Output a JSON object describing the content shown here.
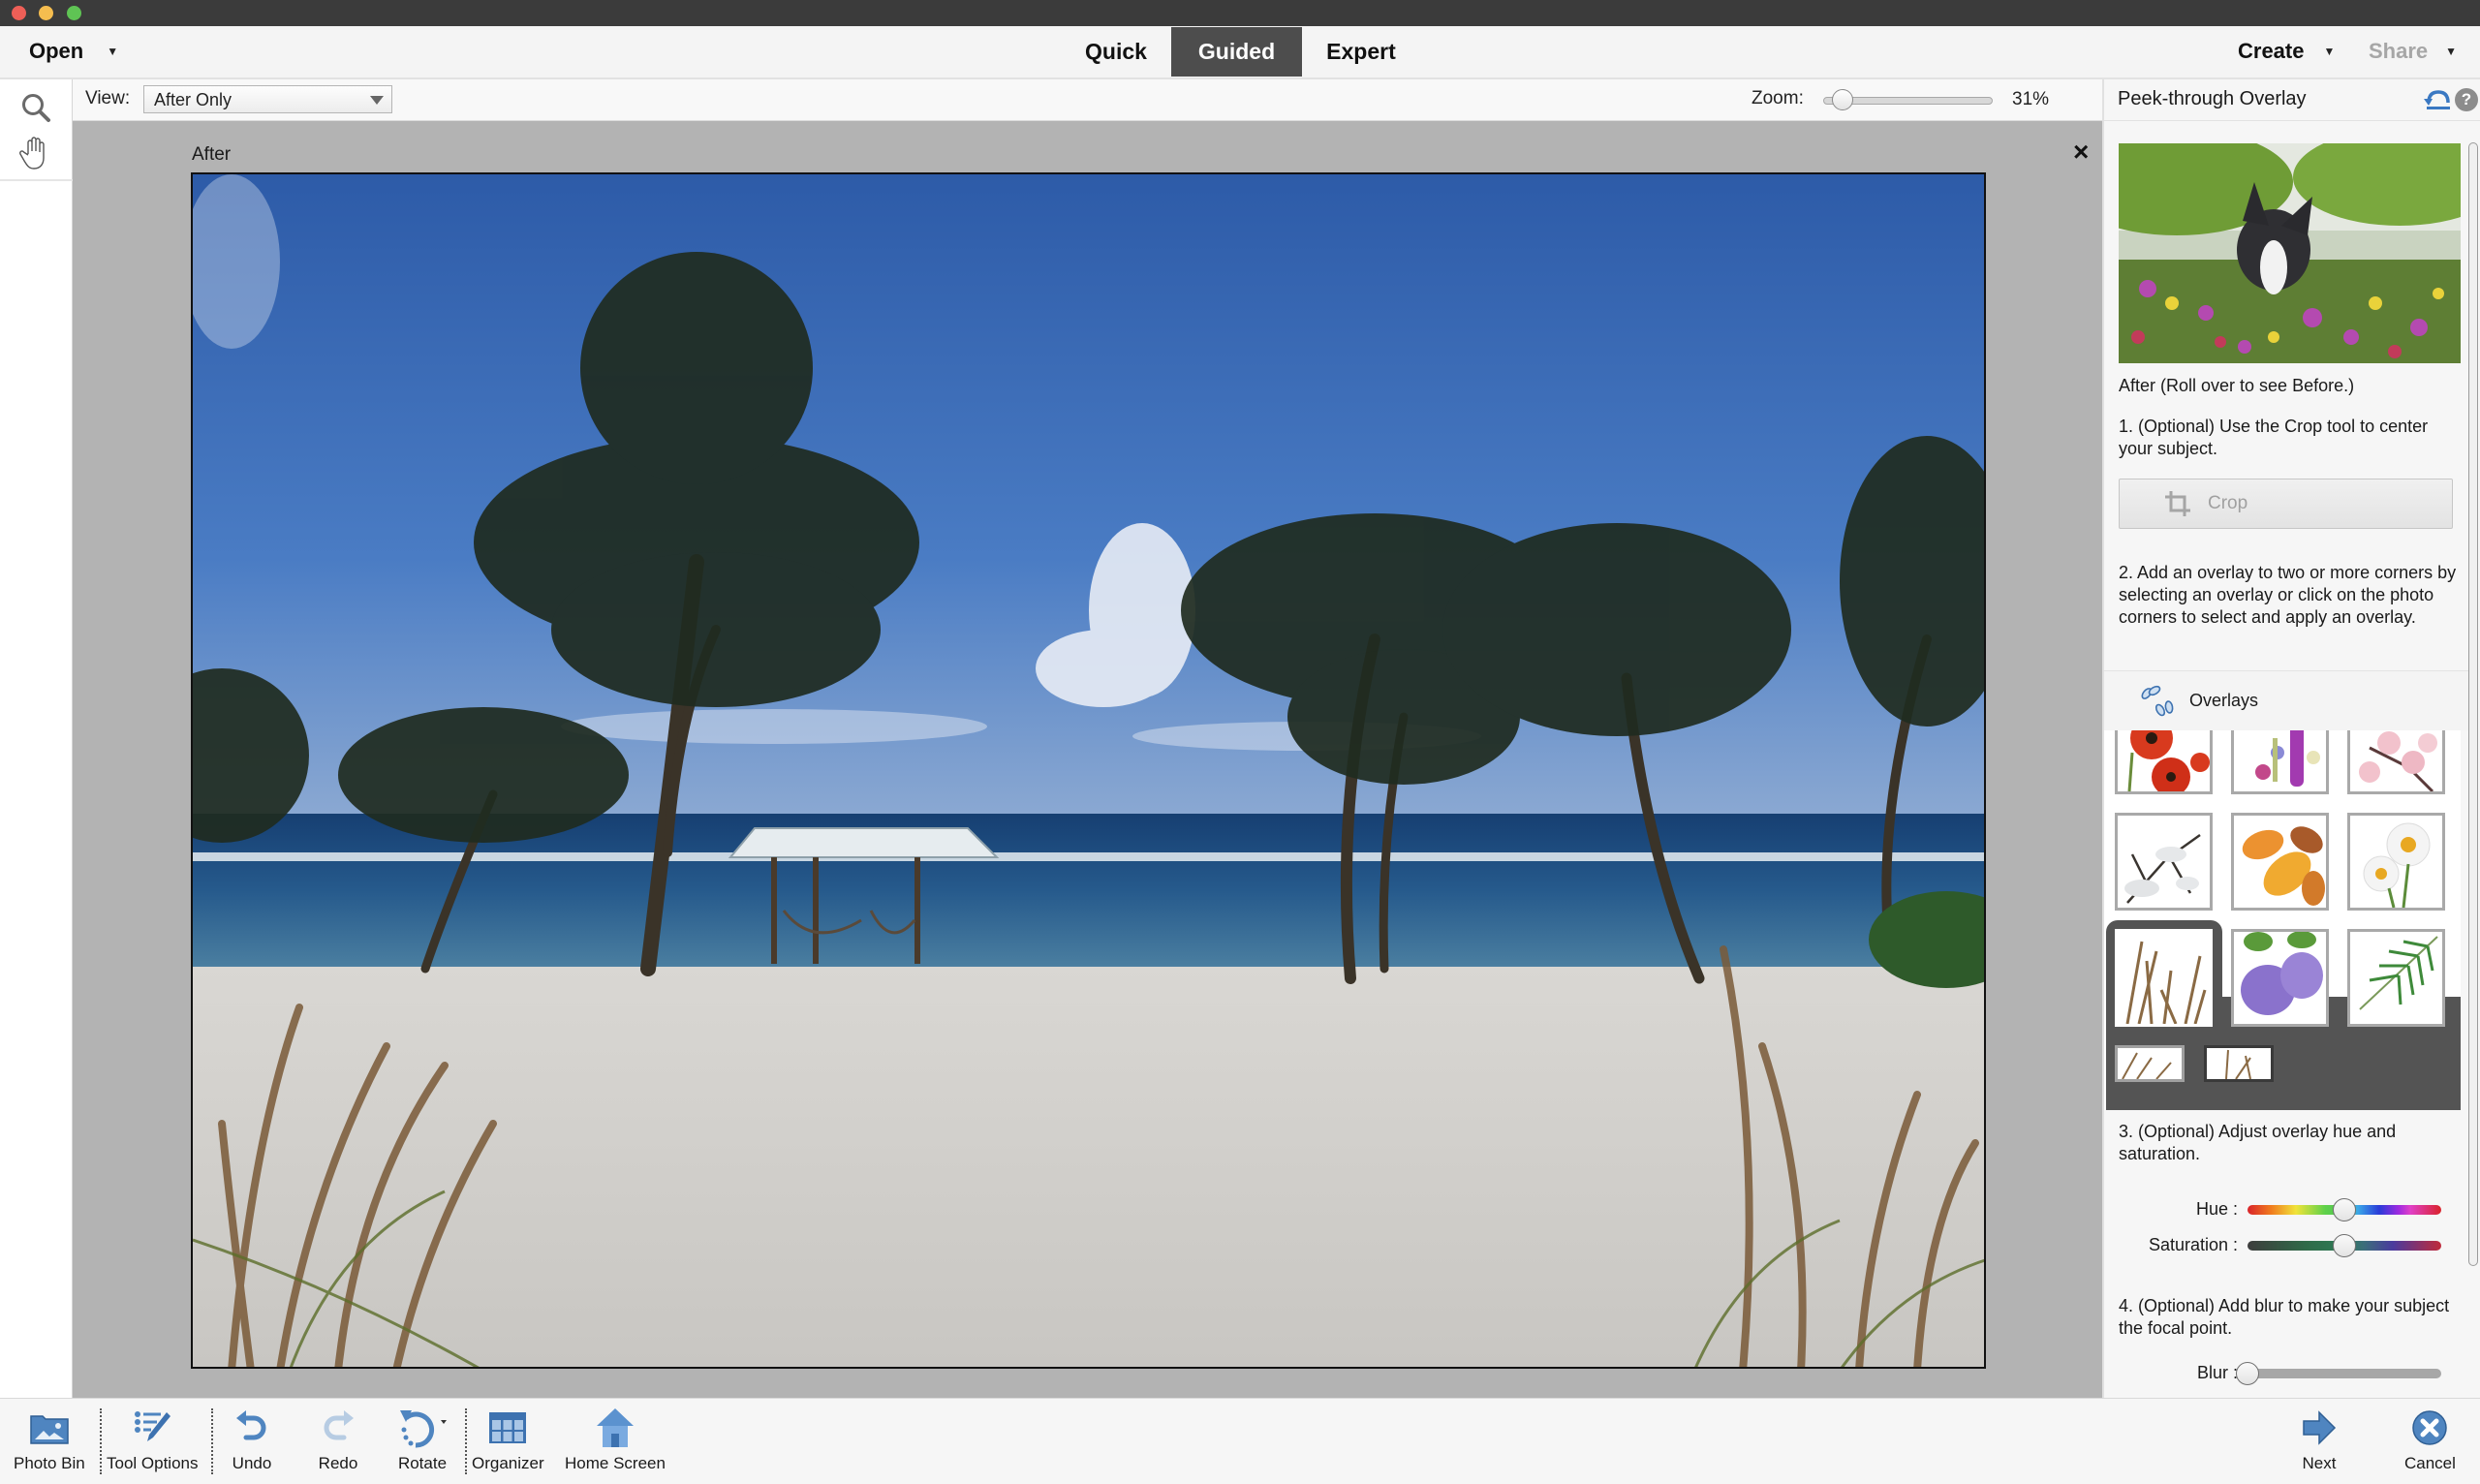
{
  "window": {
    "traffic_lights": [
      "close",
      "minimize",
      "maximize"
    ]
  },
  "topbar": {
    "open_label": "Open",
    "modes": [
      {
        "label": "Quick",
        "active": false
      },
      {
        "label": "Guided",
        "active": true
      },
      {
        "label": "Expert",
        "active": false
      }
    ],
    "create_label": "Create",
    "share_label": "Share"
  },
  "options": {
    "view_label": "View:",
    "view_value": "After Only",
    "zoom_label": "Zoom:",
    "zoom_value": "31%",
    "zoom_percent": 31
  },
  "tools": [
    {
      "name": "zoom-tool",
      "icon": "magnifier-icon"
    },
    {
      "name": "hand-tool",
      "icon": "hand-icon"
    }
  ],
  "canvas": {
    "label": "After",
    "close_symbol": "×",
    "photo_description": "Beach with palm trees, gazebo with hammocks, ocean and sea grass in foreground"
  },
  "panel": {
    "title": "Peek-through Overlay",
    "preview_caption": "After (Roll over to see Before.)",
    "step1": "1. (Optional) Use the Crop tool to center your subject.",
    "crop_label": "Crop",
    "step2": "2. Add an overlay to two or more corners by selecting an overlay or click on the photo corners to select and apply an overlay.",
    "overlays_label": "Overlays",
    "overlays": [
      {
        "name": "poppies",
        "selected": false
      },
      {
        "name": "wildflowers",
        "selected": false
      },
      {
        "name": "cherry-blossom",
        "selected": false
      },
      {
        "name": "snowy-branch",
        "selected": false
      },
      {
        "name": "autumn-oak-leaves",
        "selected": false
      },
      {
        "name": "daisies",
        "selected": false
      },
      {
        "name": "dry-grass",
        "selected": true
      },
      {
        "name": "lilac",
        "selected": false
      },
      {
        "name": "palm-frond",
        "selected": false
      }
    ],
    "overlay_variants": [
      {
        "name": "grass-variant-1",
        "selected": false
      },
      {
        "name": "grass-variant-2",
        "selected": true
      }
    ],
    "step3": "3. (Optional) Adjust overlay hue and saturation.",
    "hue_label": "Hue :",
    "hue_value": 0.5,
    "saturation_label": "Saturation :",
    "saturation_value": 0.5,
    "step4": "4. (Optional) Add blur to make your subject the focal point.",
    "blur_label": "Blur :",
    "blur_value": 0
  },
  "bottombar": {
    "items": [
      {
        "label": "Photo Bin",
        "icon": "photo-bin-icon"
      },
      {
        "label": "Tool Options",
        "icon": "tool-options-icon"
      },
      {
        "label": "Undo",
        "icon": "undo-icon"
      },
      {
        "label": "Redo",
        "icon": "redo-icon"
      },
      {
        "label": "Rotate",
        "icon": "rotate-icon"
      },
      {
        "label": "Organizer",
        "icon": "organizer-icon"
      },
      {
        "label": "Home Screen",
        "icon": "home-icon"
      }
    ],
    "next_label": "Next",
    "cancel_label": "Cancel"
  },
  "colors": {
    "accent_blue": "#4a86c5",
    "active_tab": "#4d4d4d",
    "canvas_bg": "#b3b3b3"
  }
}
